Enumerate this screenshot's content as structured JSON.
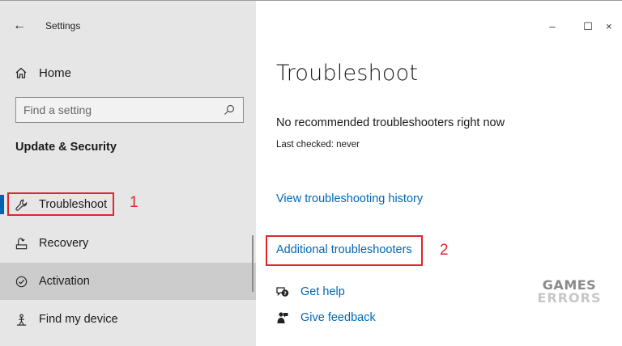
{
  "titlebar": {
    "back_icon": "back-arrow-icon",
    "title": "Settings",
    "minimize": "–",
    "maximize": "☐",
    "close": "×"
  },
  "sidebar": {
    "home_label": "Home",
    "search_placeholder": "Find a setting",
    "section_title": "Update & Security",
    "items": [
      {
        "label": "Troubleshoot",
        "icon": "wrench-icon",
        "selected": true
      },
      {
        "label": "Recovery",
        "icon": "recovery-icon"
      },
      {
        "label": "Activation",
        "icon": "check-circle-icon"
      },
      {
        "label": "Find my device",
        "icon": "person-location-icon"
      }
    ]
  },
  "main": {
    "title": "Troubleshoot",
    "no_recommendations": "No recommended troubleshooters right now",
    "last_checked": "Last checked: never",
    "history_link": "View troubleshooting history",
    "additional_link": "Additional troubleshooters",
    "get_help": "Get help",
    "give_feedback": "Give feedback"
  },
  "annotations": {
    "label_1": "1",
    "label_2": "2",
    "color": "#e0262c"
  },
  "watermark": {
    "line1": "GAMES",
    "line2": "ERRORS"
  },
  "colors": {
    "sidebar_bg": "#e6e6e6",
    "selected_bg": "#cccccc",
    "accent": "#0063b1",
    "link": "#0067b8"
  }
}
